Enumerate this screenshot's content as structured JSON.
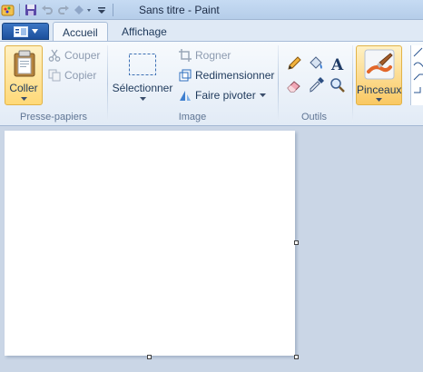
{
  "window": {
    "title": "Sans titre - Paint"
  },
  "tabs": [
    {
      "label": "Accueil",
      "active": true
    },
    {
      "label": "Affichage",
      "active": false
    }
  ],
  "groups": {
    "clipboard": {
      "label": "Presse-papiers",
      "paste_label": "Coller",
      "cut_label": "Couper",
      "copy_label": "Copier"
    },
    "image": {
      "label": "Image",
      "select_label": "Sélectionner",
      "crop_label": "Rogner",
      "resize_label": "Redimensionner",
      "rotate_label": "Faire pivoter"
    },
    "tools": {
      "label": "Outils",
      "items": [
        "pencil-icon",
        "fill-bucket-icon",
        "text-icon",
        "eraser-icon",
        "color-picker-icon",
        "magnifier-icon"
      ]
    },
    "brushes": {
      "label": "Pinceaux"
    }
  },
  "colors": {
    "accent": "#1c4f9c",
    "canvas": "#ffffff",
    "workspace": "#cad6e6",
    "brush_highlight": "#f9c863"
  }
}
